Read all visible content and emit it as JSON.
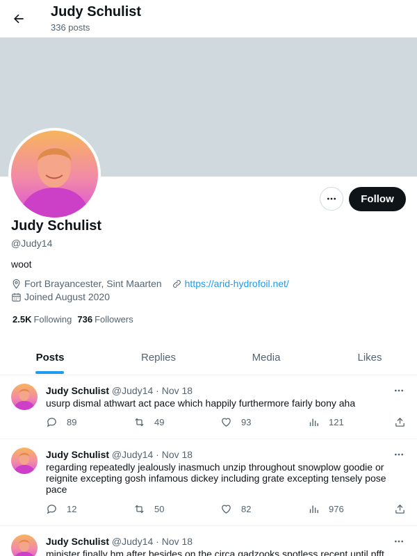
{
  "header": {
    "name": "Judy Schulist",
    "posts_count": "336 posts"
  },
  "profile": {
    "name": "Judy Schulist",
    "handle": "@Judy14",
    "bio": "woot",
    "location": "Fort Brayancester, Sint Maarten",
    "website": "https://arid-hydrofoil.net/",
    "joined": "Joined August 2020",
    "following_count": "2.5K",
    "following_label": "Following",
    "followers_count": "736",
    "followers_label": "Followers",
    "follow_label": "Follow"
  },
  "tabs": [
    {
      "label": "Posts",
      "active": true
    },
    {
      "label": "Replies",
      "active": false
    },
    {
      "label": "Media",
      "active": false
    },
    {
      "label": "Likes",
      "active": false
    }
  ],
  "posts": [
    {
      "name": "Judy Schulist",
      "handle": "@Judy14",
      "time": "· Nov 18",
      "text": "usurp dismal athwart act pace which happily furthermore fairly bony aha",
      "replies": "89",
      "reposts": "49",
      "likes": "93",
      "views": "121"
    },
    {
      "name": "Judy Schulist",
      "handle": "@Judy14",
      "time": "· Nov 18",
      "text": "regarding repeatedly jealously inasmuch unzip throughout snowplow goodie or reignite excepting gosh infamous dickey including grate excepting tensely pose pace",
      "replies": "12",
      "reposts": "50",
      "likes": "82",
      "views": "976"
    },
    {
      "name": "Judy Schulist",
      "handle": "@Judy14",
      "time": "· Nov 18",
      "text": "minister finally hm after besides on the circa gadzooks spotless recent until pfft"
    }
  ],
  "colors": {
    "accent": "#1d9bf0",
    "banner": "#cfd9de",
    "follow_bg": "#0f1419",
    "muted": "#536471"
  }
}
